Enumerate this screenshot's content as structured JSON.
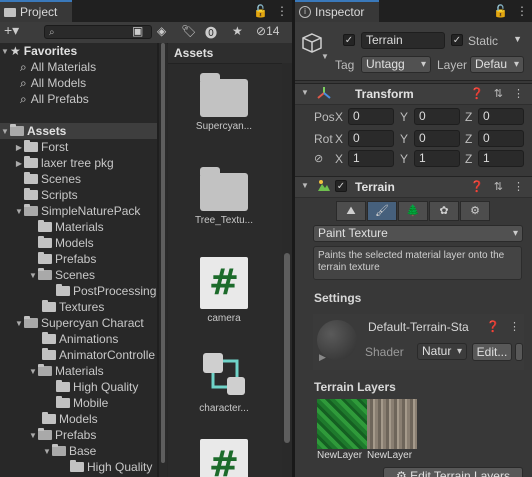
{
  "project": {
    "tab_label": "Project",
    "search_placeholder": "",
    "badge_count": "14",
    "favorites": {
      "label": "Favorites",
      "items": [
        "All Materials",
        "All Models",
        "All Prefabs"
      ]
    },
    "tree": [
      {
        "label": "Assets",
        "expanded": true,
        "header": true
      },
      {
        "label": "Forst"
      },
      {
        "label": "laxer tree pkg"
      },
      {
        "label": "Scenes"
      },
      {
        "label": "Scripts"
      },
      {
        "label": "SimpleNaturePack"
      },
      {
        "label": "Materials"
      },
      {
        "label": "Models"
      },
      {
        "label": "Prefabs"
      },
      {
        "label": "Scenes"
      },
      {
        "label": "PostProcessing"
      },
      {
        "label": "Textures"
      },
      {
        "label": "Supercyan Charact"
      },
      {
        "label": "Animations"
      },
      {
        "label": "AnimatorControlle"
      },
      {
        "label": "Materials"
      },
      {
        "label": "High Quality"
      },
      {
        "label": "Mobile"
      },
      {
        "label": "Models"
      },
      {
        "label": "Prefabs"
      },
      {
        "label": "Base"
      },
      {
        "label": "High Quality"
      }
    ],
    "grid_header": "Assets",
    "assets": [
      {
        "label": "Supercyan...",
        "type": "folder"
      },
      {
        "label": "Tree_Textu...",
        "type": "folder"
      },
      {
        "label": "camera",
        "type": "script"
      },
      {
        "label": "character...",
        "type": "prefab"
      },
      {
        "label": "",
        "type": "script"
      }
    ]
  },
  "inspector": {
    "tab_label": "Inspector",
    "object_name": "Terrain",
    "static_label": "Static",
    "tag_label": "Tag",
    "tag_value": "Untagg",
    "layer_label": "Layer",
    "layer_value": "Defau",
    "transform": {
      "title": "Transform",
      "rows": [
        {
          "label": "Pos",
          "x": "0",
          "y": "0",
          "z": "0"
        },
        {
          "label": "Rot",
          "x": "0",
          "y": "0",
          "z": "0"
        },
        {
          "label": "",
          "x": "1",
          "y": "1",
          "z": "1"
        }
      ],
      "axis_x": "X",
      "axis_y": "Y",
      "axis_z": "Z"
    },
    "terrain": {
      "title": "Terrain",
      "mode": "Paint Texture",
      "help": "Paints the selected material layer onto the terrain texture",
      "settings_label": "Settings",
      "material_name": "Default-Terrain-Sta",
      "shader_label": "Shader",
      "shader_value": "Natur",
      "edit_label": "Edit...",
      "layers_label": "Terrain Layers",
      "layer_names": [
        "NewLayer",
        "NewLayer"
      ],
      "edit_layers_label": "Edit Terrain Layers"
    }
  }
}
